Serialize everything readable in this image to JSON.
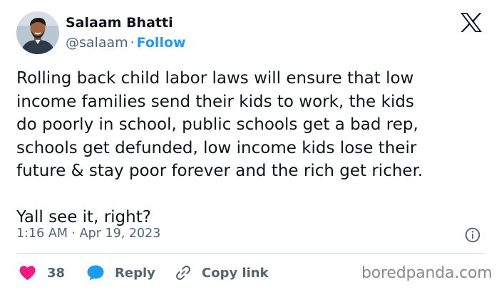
{
  "author": {
    "name": "Salaam Bhatti",
    "handle": "@salaam",
    "separator": "·",
    "follow_label": "Follow"
  },
  "tweet": {
    "lines": [
      "Rolling back child labor laws will ensure that low",
      "income families send their kids to work, the kids",
      "do poorly in school, public schools get a bad rep,",
      "schools get defunded, low income kids lose their",
      "future & stay poor forever and the rich get richer."
    ],
    "closing_line": "Yall see it, right?",
    "timestamp": "1:16 AM · Apr 19, 2023"
  },
  "actions": {
    "like_count": "38",
    "reply_label": "Reply",
    "copy_label": "Copy link"
  },
  "icons": {
    "brand": "x-logo-icon",
    "info": "info-icon",
    "like": "heart-icon",
    "reply": "speech-bubble-icon",
    "copy": "link-icon"
  },
  "colors": {
    "text": "#0f1419",
    "secondary": "#536471",
    "follow": "#1d9bf0",
    "like": "#f91880",
    "reply": "#1d9bf0",
    "divider": "#cfd9de"
  },
  "watermark": "boredpanda.com"
}
